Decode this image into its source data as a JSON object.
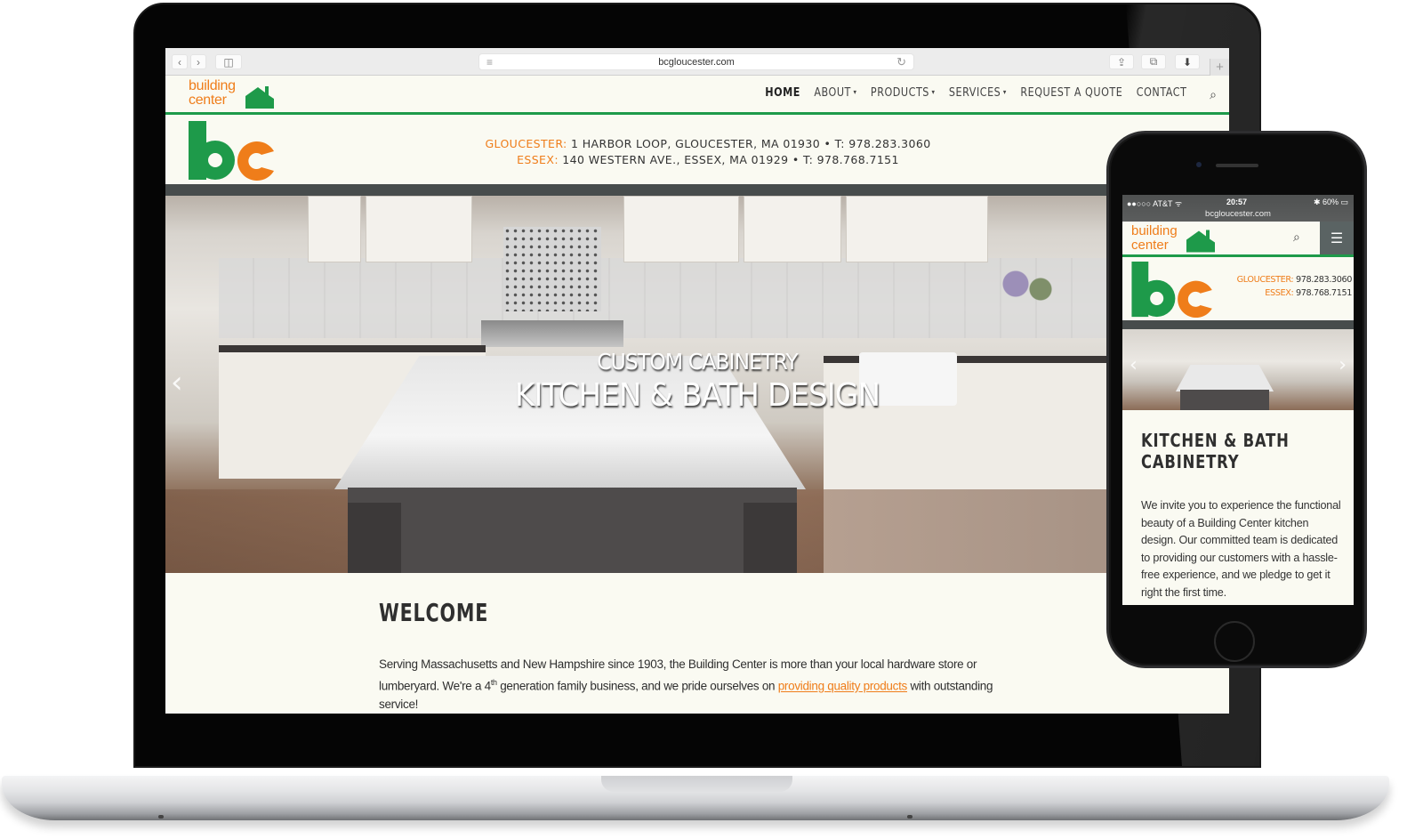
{
  "browser": {
    "url": "bcgloucester.com",
    "back_icon": "‹",
    "forward_icon": "›",
    "sidebar_icon": "◫",
    "reader_icon": "≡",
    "reload_icon": "↻",
    "share_icon": "⇪",
    "tabs_icon": "⧉",
    "download_icon": "⬇",
    "new_tab_icon": "+"
  },
  "site": {
    "logo_line1": "building",
    "logo_line2": "center",
    "colors": {
      "green": "#1e9a4a",
      "orange": "#ef7d1a",
      "dark_band": "#474c4c",
      "background": "#fafaf2"
    },
    "nav": [
      {
        "label": "HOME",
        "active": true,
        "dropdown": false
      },
      {
        "label": "ABOUT",
        "dropdown": true
      },
      {
        "label": "PRODUCTS",
        "dropdown": true
      },
      {
        "label": "SERVICES",
        "dropdown": true
      },
      {
        "label": "REQUEST A QUOTE",
        "dropdown": false
      },
      {
        "label": "CONTACT",
        "dropdown": false
      }
    ],
    "caret": "▾",
    "search_icon": "⌕",
    "locations": [
      {
        "city": "GLOUCESTER:",
        "details": " 1 HARBOR LOOP, GLOUCESTER, MA 01930 • T: 978.283.3060"
      },
      {
        "city": "ESSEX:",
        "details": " 140 WESTERN AVE., ESSEX, MA 01929 • T: 978.768.7151"
      }
    ],
    "hero": {
      "subtitle": "CUSTOM CABINETRY",
      "title": "KITCHEN & BATH DESIGN",
      "prev_icon": "‹",
      "next_icon": "›"
    },
    "welcome": {
      "title": "WELCOME",
      "text_before": "Serving Massachusetts and New Hampshire since 1903, the Building Center is more than your local hardware store or lumberyard. We're a 4",
      "sup": "th",
      "text_middle": " generation family business, and we pride ourselves on ",
      "link": "providing quality products",
      "text_after": " with outstanding service!"
    }
  },
  "phone": {
    "status": {
      "carrier": "●●○○○ AT&T ᯤ",
      "time": "20:57",
      "battery": "✱ 60% ▭",
      "url": "bcgloucester.com"
    },
    "logo_line1": "building",
    "logo_line2": "center",
    "search_icon": "⌕",
    "menu_icon": "☰",
    "locations": [
      {
        "city": "GLOUCESTER:",
        "phone": " 978.283.3060"
      },
      {
        "city": "ESSEX:",
        "phone": " 978.768.7151"
      }
    ],
    "prev_icon": "‹",
    "next_icon": "›",
    "content_title": "KITCHEN & BATH CABINETRY",
    "content_text": "We invite you to experience the functional beauty of a Building Center kitchen design. Our committed team is dedicated to providing our customers with a hassle-free experience, and we pledge to get it right the first time."
  }
}
